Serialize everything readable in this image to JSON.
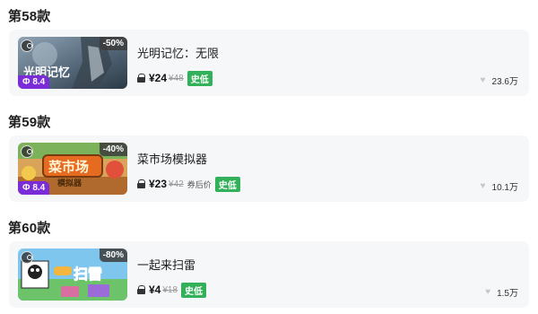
{
  "items": [
    {
      "heading": "第58款",
      "title": "光明记忆：无限",
      "discount": "-50%",
      "rating": "8.4",
      "price": "¥24",
      "original_price": "¥48",
      "note": "",
      "badge": "史低",
      "likes": "23.6万",
      "thumb_text": "光明记忆"
    },
    {
      "heading": "第59款",
      "title": "菜市场模拟器",
      "discount": "-40%",
      "rating": "8.4",
      "price": "¥23",
      "original_price": "¥42",
      "note": "券后价",
      "badge": "史低",
      "likes": "10.1万",
      "thumb_text": "菜市场",
      "thumb_subtext": "模拟器"
    },
    {
      "heading": "第60款",
      "title": "一起来扫雷",
      "discount": "-80%",
      "rating": "",
      "price": "¥4",
      "original_price": "¥18",
      "note": "",
      "badge": "史低",
      "likes": "1.5万",
      "thumb_text": "扫雷"
    }
  ],
  "colors": {
    "rating_bg": "#7a2cd9",
    "badge_bg": "#32b05a",
    "card_bg": "#f6f7f9"
  },
  "icons": {
    "platform": "steam-icon",
    "lock": "lock-icon",
    "like": "heart-icon"
  }
}
